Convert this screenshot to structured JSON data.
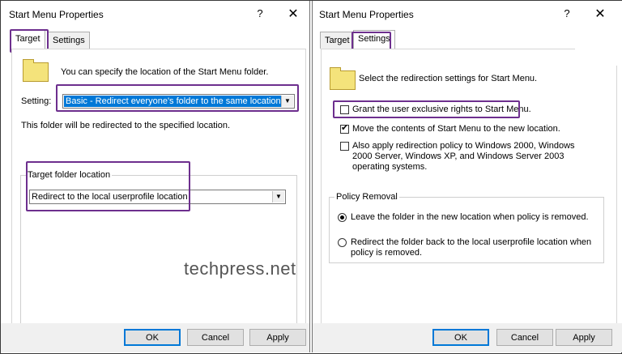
{
  "left_dialog": {
    "title": "Start Menu Properties",
    "help": "?",
    "close": "✕",
    "tabs": [
      "Target",
      "Settings"
    ],
    "description": "You can specify the location of the Start Menu folder.",
    "setting_label": "Setting:",
    "setting_value": "Basic - Redirect everyone's folder to the same location",
    "redirect_note": "This folder will be redirected to the specified location.",
    "target_group_label": "Target folder location",
    "target_value": "Redirect to the local userprofile location",
    "buttons": {
      "ok": "OK",
      "cancel": "Cancel",
      "apply": "Apply"
    }
  },
  "right_dialog": {
    "title": "Start Menu Properties",
    "help": "?",
    "close": "✕",
    "tabs": [
      "Target",
      "Settings"
    ],
    "description": "Select the redirection settings for Start Menu.",
    "options": [
      {
        "label": "Grant the user exclusive rights to Start Menu.",
        "checked": false
      },
      {
        "label": "Move the contents of Start Menu to the new location.",
        "checked": true
      },
      {
        "label": "Also apply redirection policy to Windows 2000, Windows 2000 Server, Windows XP, and Windows Server 2003 operating systems.",
        "checked": false
      }
    ],
    "policy_group_label": "Policy Removal",
    "policy_options": [
      {
        "label": "Leave the folder in the new location when policy is removed.",
        "selected": true
      },
      {
        "label": "Redirect the folder back to the local userprofile location when policy is removed.",
        "selected": false
      }
    ],
    "buttons": {
      "ok": "OK",
      "cancel": "Cancel",
      "apply": "Apply"
    }
  },
  "watermark": "techpress.net",
  "colors": {
    "highlight_border": "#6d2f8e",
    "selection_blue": "#0078d7",
    "folder_yellow": "#f4e37b"
  }
}
